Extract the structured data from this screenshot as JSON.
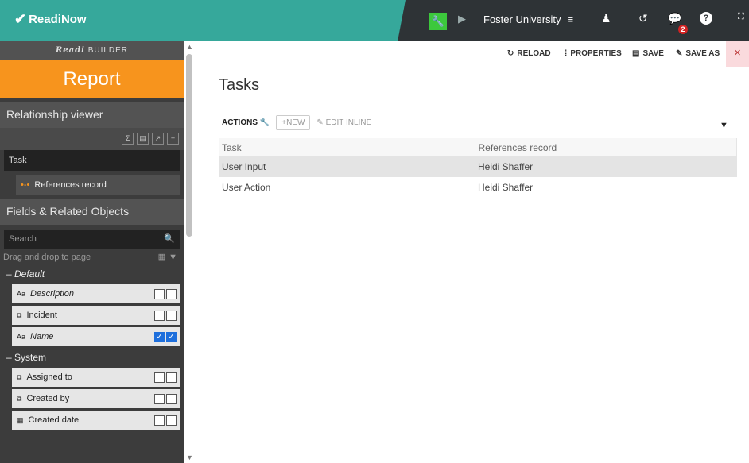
{
  "topbar": {
    "logo": "ReadiNow",
    "tenant": "Foster University",
    "notification_count": "2",
    "icons": [
      "wrench-icon",
      "play-icon",
      "menu-icon",
      "user-icon",
      "history-icon",
      "chat-icon",
      "help-icon",
      "expand-icon"
    ]
  },
  "sidebar": {
    "builder_label_prefix": "Readi",
    "builder_label": "BUILDER",
    "report_title": "Report",
    "relationship_viewer": "Relationship viewer",
    "tool_icons": [
      "Σ",
      "▤",
      "↗",
      "+"
    ],
    "root_field": "Task",
    "relationship": "References record",
    "fields_heading": "Fields & Related Objects",
    "search_placeholder": "Search",
    "drag_hint": "Drag and drop to page",
    "groups": [
      {
        "name": "Default",
        "items": [
          {
            "label": "Description",
            "icon": "Aa",
            "checked": false
          },
          {
            "label": "Incident",
            "icon": "⧉",
            "checked": false
          },
          {
            "label": "Name",
            "icon": "Aa",
            "checked": true
          }
        ]
      },
      {
        "name": "System",
        "items": [
          {
            "label": "Assigned to",
            "icon": "⧉",
            "checked": false
          },
          {
            "label": "Created by",
            "icon": "⧉",
            "checked": false
          },
          {
            "label": "Created date",
            "icon": "▦",
            "checked": false
          }
        ]
      }
    ]
  },
  "toolbar": {
    "reload": "RELOAD",
    "properties": "PROPERTIES",
    "save": "SAVE",
    "save_as": "SAVE AS"
  },
  "report": {
    "title": "Tasks",
    "actions_label": "ACTIONS",
    "new_label": "NEW",
    "edit_inline_label": "EDIT INLINE",
    "columns": [
      "Task",
      "References record"
    ],
    "rows": [
      [
        "User Input",
        "Heidi Shaffer"
      ],
      [
        "User Action",
        "Heidi Shaffer"
      ]
    ]
  },
  "colors": {
    "accent": "#f7941d",
    "brand": "#36a89b",
    "topbar": "#2e3336",
    "sidebar": "#3c3c3c"
  }
}
